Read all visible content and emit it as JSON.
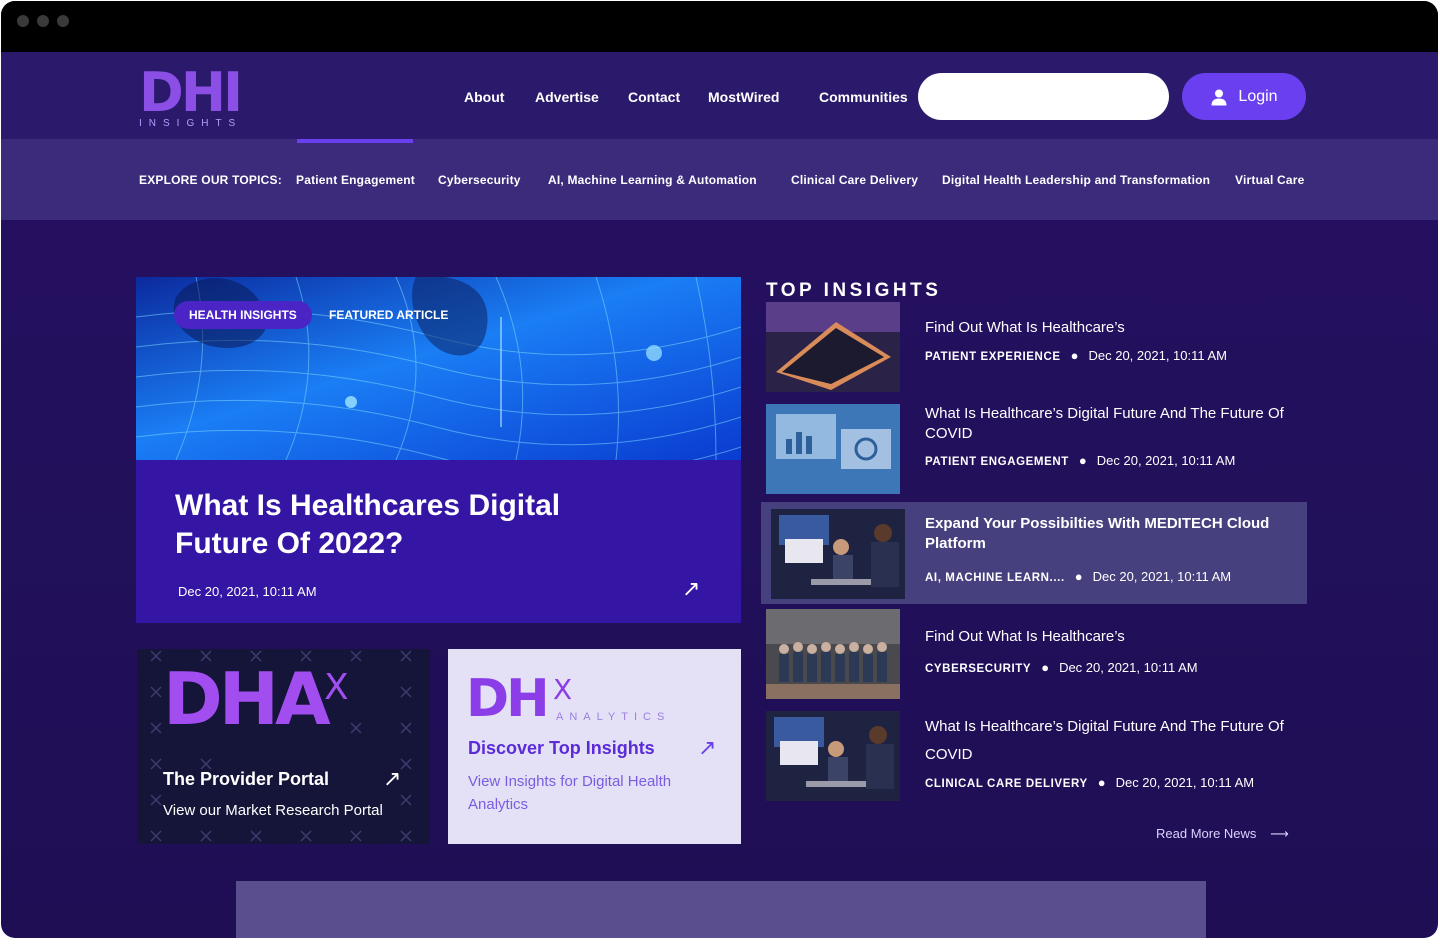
{
  "header": {
    "logo_text": "DHI",
    "logo_sub": "INSIGHTS",
    "nav": [
      "About",
      "Advertise",
      "Contact",
      "MostWired",
      "Communities"
    ],
    "search_placeholder": "",
    "login_label": "Login"
  },
  "topics": {
    "label": "EXPLORE OUR TOPICS:",
    "items": [
      "Patient Engagement",
      "Cybersecurity",
      "AI, Machine Learning & Automation",
      "Clinical Care Delivery",
      "Digital Health Leadership and Transformation",
      "Virtual Care"
    ]
  },
  "featured": {
    "tag": "HEALTH INSIGHTS",
    "label": "FEATURED ARTICLE",
    "title": "What Is Healthcares Digital Future Of 2022?",
    "date": "Dec 20, 2021, 10:11 AM"
  },
  "cards": {
    "dhax": {
      "logo": "DHA",
      "logo_x": "X",
      "title": "The Provider Portal",
      "subtitle": "View our Market Research Portal"
    },
    "analytics": {
      "logo": "DH",
      "logo_x": "X",
      "logo_sub": "ANALYTICS",
      "title": "Discover Top Insights",
      "subtitle": "View Insights for Digital Health Analytics"
    }
  },
  "top_insights": {
    "heading": "TOP INSIGHTS",
    "items": [
      {
        "title": "Find Out What Is Healthcare’s",
        "category": "PATIENT EXPERIENCE",
        "date": "Dec 20, 2021, 10:11 AM"
      },
      {
        "title": "What Is Healthcare’s Digital Future And The Future Of COVID",
        "category": "PATIENT ENGAGEMENT",
        "date": "Dec 20, 2021, 10:11 AM"
      },
      {
        "title": "Expand Your Possibilties With MEDITECH Cloud Platform",
        "category": "AI, MACHINE LEARN....",
        "date": "Dec 20, 2021, 10:11 AM"
      },
      {
        "title": "Find Out What Is Healthcare’s",
        "category": "CYBERSECURITY",
        "date": "Dec 20, 2021, 10:11 AM"
      },
      {
        "title": "What Is Healthcare’s Digital Future And The Future Of COVID",
        "category": "CLINICAL CARE DELIVERY",
        "date": "Dec 20, 2021, 10:11 AM"
      }
    ],
    "read_more": "Read More News"
  },
  "colors": {
    "accent": "#6a3ff0",
    "background": "#22105c",
    "logo": "#8b4fe6"
  }
}
